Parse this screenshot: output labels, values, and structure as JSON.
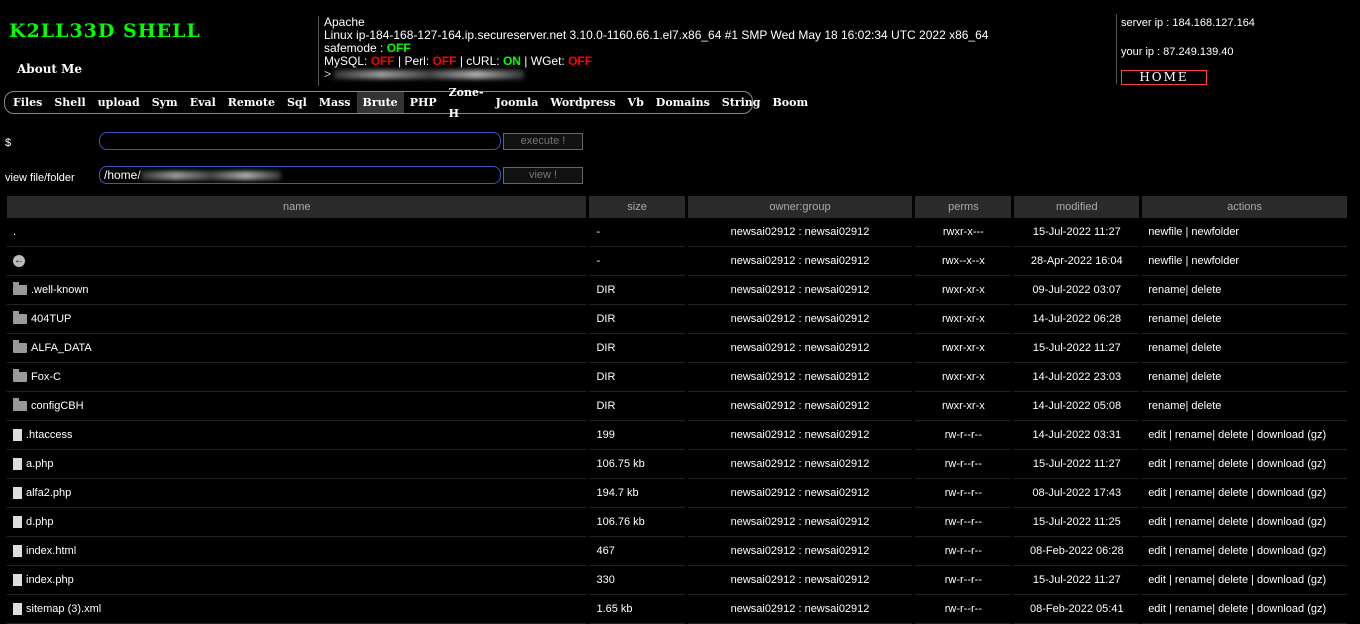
{
  "header": {
    "title": "K2LL33D SHELL",
    "about": "About Me"
  },
  "sysinfo": {
    "server": "Apache",
    "uname": "Linux ip-184-168-127-164.ip.secureserver.net 3.10.0-1160.66.1.el7.x86_64 #1 SMP Wed May 18 16:02:34 UTC 2022 x86_64",
    "safemode_label": "safemode : ",
    "safemode": "OFF",
    "mysql_label": "MySQL: ",
    "mysql": "OFF",
    "perl_label": " | Perl: ",
    "perl": "OFF",
    "curl_label": " | cURL: ",
    "curl": "ON",
    "wget_label": " | WGet: ",
    "wget": "OFF",
    "path_prefix": " > "
  },
  "server_info": {
    "server_ip": "server ip : 184.168.127.164",
    "your_ip": "your ip : 87.249.139.40",
    "home": "HOME"
  },
  "nav": [
    "Files",
    "Shell",
    "upload",
    "Sym",
    "Eval",
    "Remote",
    "Sql",
    "Mass",
    "Brute",
    "PHP",
    "Zone-H",
    "Joomla",
    "Wordpress",
    "Vb",
    "Domains",
    "String",
    "Boom"
  ],
  "nav_active": "Brute",
  "exec": {
    "label": "$",
    "value": "",
    "button": "execute !"
  },
  "view": {
    "label": "view file/folder",
    "value": "/home/",
    "button": "view !"
  },
  "table": {
    "headers": [
      "name",
      "size",
      "owner:group",
      "perms",
      "modified",
      "actions"
    ],
    "rows": [
      {
        "icon": "none",
        "name": ".",
        "size": "-",
        "owner": "newsai02912 : newsai02912",
        "perms": "rwxr-x---",
        "modified": "15-Jul-2022 11:27",
        "actions": "newfile | newfolder"
      },
      {
        "icon": "back",
        "name": "",
        "size": "-",
        "owner": "newsai02912 : newsai02912",
        "perms": "rwx--x--x",
        "modified": "28-Apr-2022 16:04",
        "actions": "newfile | newfolder"
      },
      {
        "icon": "folder",
        "name": ".well-known",
        "size": "DIR",
        "owner": "newsai02912 : newsai02912",
        "perms": "rwxr-xr-x",
        "modified": "09-Jul-2022 03:07",
        "actions": "rename| delete"
      },
      {
        "icon": "folder",
        "name": "404TUP",
        "size": "DIR",
        "owner": "newsai02912 : newsai02912",
        "perms": "rwxr-xr-x",
        "modified": "14-Jul-2022 06:28",
        "actions": "rename| delete"
      },
      {
        "icon": "folder",
        "name": "ALFA_DATA",
        "size": "DIR",
        "owner": "newsai02912 : newsai02912",
        "perms": "rwxr-xr-x",
        "modified": "15-Jul-2022 11:27",
        "actions": "rename| delete"
      },
      {
        "icon": "folder",
        "name": "Fox-C",
        "size": "DIR",
        "owner": "newsai02912 : newsai02912",
        "perms": "rwxr-xr-x",
        "modified": "14-Jul-2022 23:03",
        "actions": "rename| delete"
      },
      {
        "icon": "folder",
        "name": "configCBH",
        "size": "DIR",
        "owner": "newsai02912 : newsai02912",
        "perms": "rwxr-xr-x",
        "modified": "14-Jul-2022 05:08",
        "actions": "rename| delete"
      },
      {
        "icon": "file",
        "name": ".htaccess",
        "size": "199",
        "owner": "newsai02912 : newsai02912",
        "perms": "rw-r--r--",
        "modified": "14-Jul-2022 03:31",
        "actions": "edit | rename| delete | download (gz)"
      },
      {
        "icon": "file",
        "name": "a.php",
        "size": "106.75 kb",
        "owner": "newsai02912 : newsai02912",
        "perms": "rw-r--r--",
        "modified": "15-Jul-2022 11:27",
        "actions": "edit | rename| delete | download (gz)"
      },
      {
        "icon": "file",
        "name": "alfa2.php",
        "size": "194.7 kb",
        "owner": "newsai02912 : newsai02912",
        "perms": "rw-r--r--",
        "modified": "08-Jul-2022 17:43",
        "actions": "edit | rename| delete | download (gz)"
      },
      {
        "icon": "file",
        "name": "d.php",
        "size": "106.76 kb",
        "owner": "newsai02912 : newsai02912",
        "perms": "rw-r--r--",
        "modified": "15-Jul-2022 11:25",
        "actions": "edit | rename| delete | download (gz)"
      },
      {
        "icon": "file",
        "name": "index.html",
        "size": "467",
        "owner": "newsai02912 : newsai02912",
        "perms": "rw-r--r--",
        "modified": "08-Feb-2022 06:28",
        "actions": "edit | rename| delete | download (gz)"
      },
      {
        "icon": "file",
        "name": "index.php",
        "size": "330",
        "owner": "newsai02912 : newsai02912",
        "perms": "rw-r--r--",
        "modified": "15-Jul-2022 11:27",
        "actions": "edit | rename| delete | download (gz)"
      },
      {
        "icon": "file",
        "name": "sitemap (3).xml",
        "size": "1.65 kb",
        "owner": "newsai02912 : newsai02912",
        "perms": "rw-r--r--",
        "modified": "08-Feb-2022 05:41",
        "actions": "edit | rename| delete | download (gz)"
      }
    ]
  }
}
